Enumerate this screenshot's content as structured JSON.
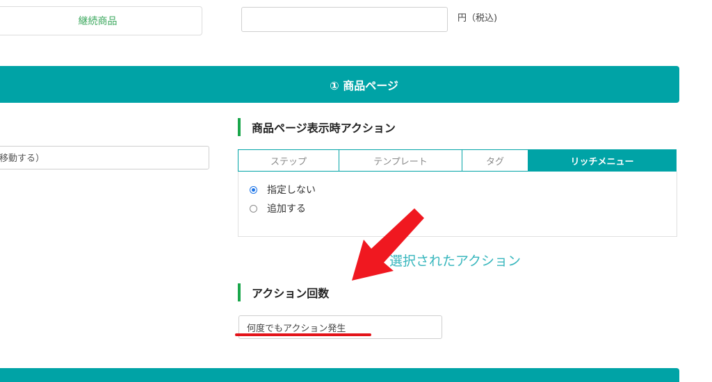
{
  "top": {
    "product_type_label": "継続商品",
    "price_value": "",
    "price_unit": "円（税込)"
  },
  "section": {
    "title": "① 商品ページ"
  },
  "left_field": {
    "value": "移動する）"
  },
  "page_action": {
    "heading": "商品ページ表示時アクション",
    "tabs": [
      "ステップ",
      "テンプレート",
      "タグ",
      "リッチメニュー"
    ],
    "active_tab": "リッチメニュー",
    "options": [
      {
        "label": "指定しない",
        "checked": true
      },
      {
        "label": "追加する",
        "checked": false
      }
    ],
    "selected_action_link": "選択されたアクション"
  },
  "action_count": {
    "heading": "アクション回数",
    "value": "何度でもアクション発生"
  },
  "colors": {
    "teal": "#00a3a6",
    "green_accent": "#1aa64b",
    "annotation_red": "#e3141a"
  }
}
